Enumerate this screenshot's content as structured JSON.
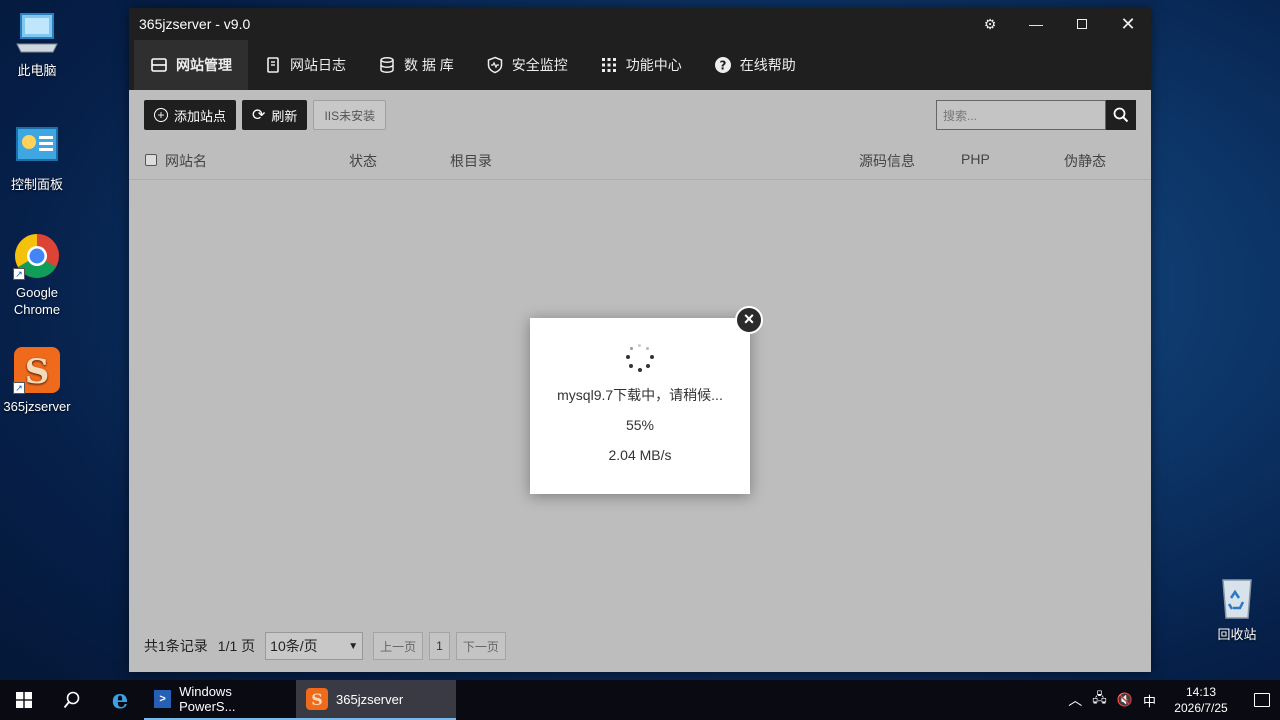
{
  "desktop": {
    "icons": [
      {
        "label": "此电脑"
      },
      {
        "label": "控制面板"
      },
      {
        "label": "Google Chrome"
      },
      {
        "label": "365jzserver"
      },
      {
        "label": "回收站"
      }
    ]
  },
  "window": {
    "title": "365jzserver - v9.0",
    "nav": [
      {
        "label": "网站管理",
        "icon": "layout-icon"
      },
      {
        "label": "网站日志",
        "icon": "log-icon"
      },
      {
        "label": "数 据 库",
        "icon": "database-icon"
      },
      {
        "label": "安全监控",
        "icon": "shield-icon"
      },
      {
        "label": "功能中心",
        "icon": "grid-icon"
      },
      {
        "label": "在线帮助",
        "icon": "help-icon"
      }
    ],
    "toolbar": {
      "add_site": "添加站点",
      "refresh": "刷新",
      "iis_status": "IIS未安装"
    },
    "search": {
      "placeholder": "搜索..."
    },
    "table": {
      "headers": {
        "name": "网站名",
        "status": "状态",
        "root": "根目录",
        "source": "源码信息",
        "php": "PHP",
        "rewrite": "伪静态"
      }
    },
    "pager": {
      "total": "共1条记录",
      "page_info": "1/1 页",
      "per_page": "10条/页",
      "prev": "上一页",
      "current": "1",
      "next": "下一页"
    }
  },
  "modal": {
    "message": "mysql9.7下载中，请稍候...",
    "progress": "55%",
    "speed": "2.04 MB/s"
  },
  "taskbar": {
    "apps": [
      {
        "label": "Windows PowerS..."
      },
      {
        "label": "365jzserver"
      }
    ],
    "ime": "中",
    "time": "14:13",
    "date": "2026/7/25"
  },
  "colors": {
    "accent": "#1f1f1f",
    "taskbar": "#0a0a12",
    "overlay_content": "#bdbdbd"
  }
}
